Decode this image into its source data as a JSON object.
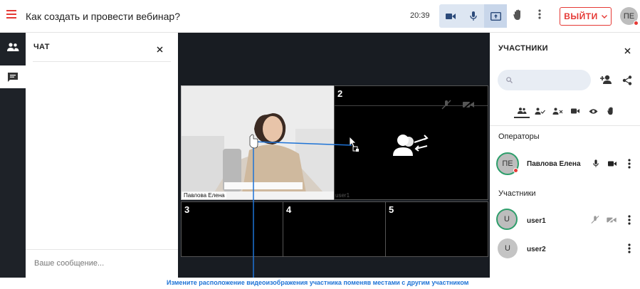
{
  "header": {
    "title": "Как создать и провести вебинар?",
    "time": "20:39",
    "exit_label": "ВЫЙТИ",
    "avatar_initials": "ПЕ",
    "accent": "#e53935"
  },
  "chat": {
    "title": "ЧАТ",
    "placeholder": "Ваше сообщение..."
  },
  "stage": {
    "cells": [
      {
        "num": "2",
        "label": "user1"
      },
      {
        "num": "3"
      },
      {
        "num": "4"
      },
      {
        "num": "5"
      }
    ],
    "main_label": "Павлова Елена"
  },
  "participants": {
    "title": "УЧАСТНИКИ",
    "operators_label": "Операторы",
    "participants_label": "Участники",
    "operator": {
      "initials": "ПЕ",
      "name": "Павлова Елена"
    },
    "users": [
      {
        "initials": "U",
        "name": "user1"
      },
      {
        "initials": "U",
        "name": "user2"
      }
    ]
  },
  "caption": "Измените расположение видеоизображения участника поменяв местами с другим участником"
}
